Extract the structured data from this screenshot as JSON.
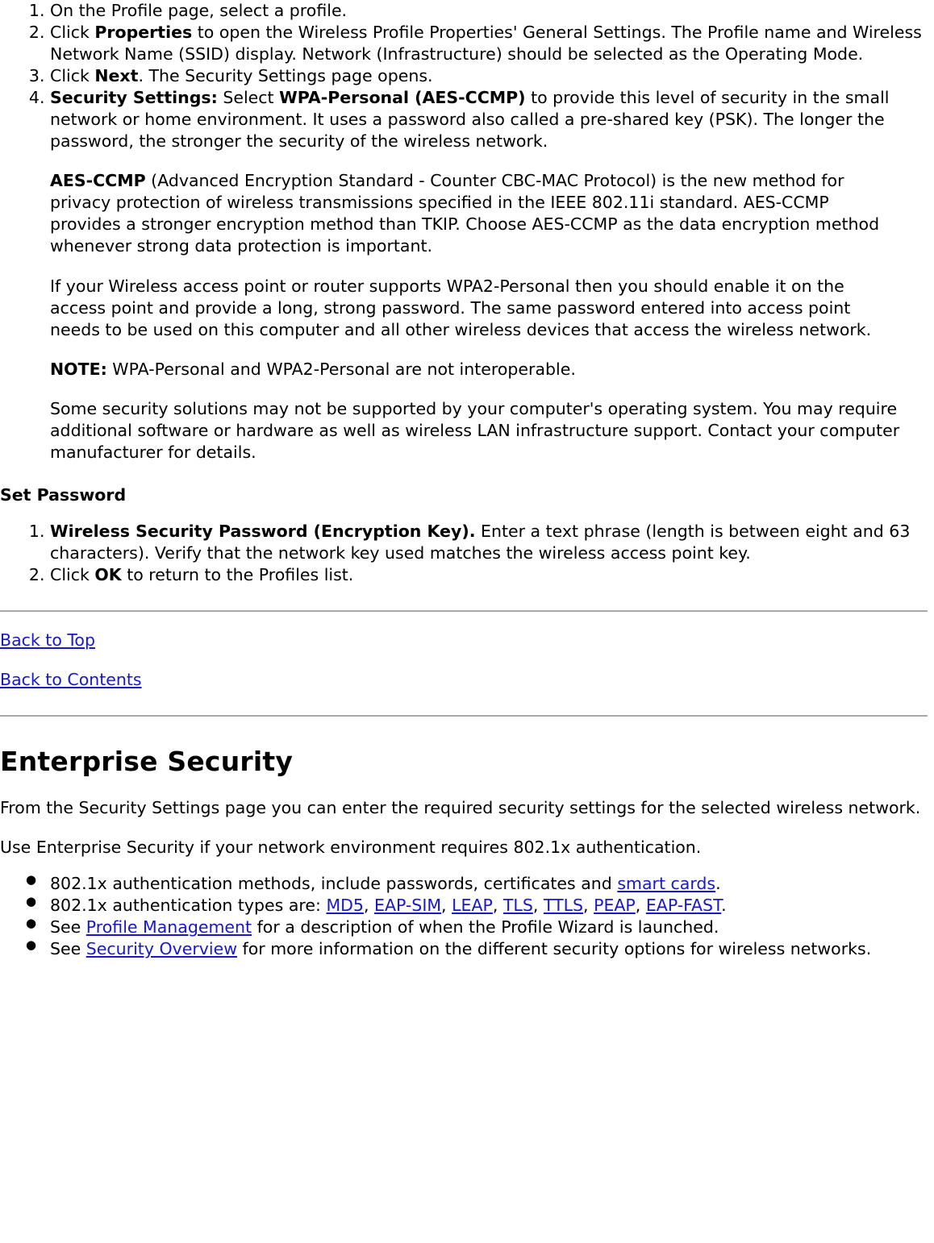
{
  "doc": {
    "steps_top": [
      {
        "id": "step-profile-select",
        "segments": [
          {
            "text": "On the Profile page, select a profile.",
            "bold": false
          }
        ]
      },
      {
        "id": "step-properties",
        "segments": [
          {
            "text": "Click ",
            "bold": false
          },
          {
            "text": "Properties",
            "bold": true
          },
          {
            "text": " to open the Wireless Profile Properties' General Settings. The Profile name and Wireless Network Name (SSID) display. Network (Infrastructure) should be selected as the Operating Mode.",
            "bold": false
          }
        ]
      },
      {
        "id": "step-next",
        "segments": [
          {
            "text": "Click ",
            "bold": false
          },
          {
            "text": "Next",
            "bold": true
          },
          {
            "text": ". The Security Settings page opens.",
            "bold": false
          }
        ]
      },
      {
        "id": "step-security-settings",
        "segments": [
          {
            "text": "Security Settings:",
            "bold": true
          },
          {
            "text": " Select ",
            "bold": false
          },
          {
            "text": "WPA-Personal (AES-CCMP)",
            "bold": true
          },
          {
            "text": " to provide this level of security in the small network or home environment. It uses a password also called a pre-shared key (PSK). The longer the password, the stronger the security of the wireless network.",
            "bold": false
          }
        ]
      }
    ],
    "paragraphs": [
      {
        "id": "para-aes-ccmp",
        "segments": [
          {
            "text": "AES-CCMP",
            "bold": true
          },
          {
            "text": " (Advanced Encryption Standard - Counter CBC-MAC Protocol) is the new method for privacy protection of wireless transmissions specified in the IEEE 802.11i standard. AES-CCMP provides a stronger encryption method than TKIP. Choose AES-CCMP as the data encryption method whenever strong data protection is important.",
            "bold": false
          }
        ]
      },
      {
        "id": "para-wpa2-router",
        "segments": [
          {
            "text": "If your Wireless access point or router supports WPA2-Personal then you should enable it on the access point and provide a long, strong password. The same password entered into access point needs to be used on this computer and all other wireless devices that access the wireless network.",
            "bold": false
          }
        ]
      },
      {
        "id": "para-note",
        "segments": [
          {
            "text": "NOTE:",
            "bold": true
          },
          {
            "text": " WPA-Personal and WPA2-Personal are not interoperable.",
            "bold": false
          }
        ]
      },
      {
        "id": "para-security-solutions",
        "segments": [
          {
            "text": "Some security solutions may not be supported by your computer's operating system. You may require additional software or hardware as well as wireless LAN infrastructure support. Contact your computer manufacturer for details.",
            "bold": false
          }
        ]
      }
    ],
    "set_password_heading": "Set Password",
    "steps_password": [
      {
        "id": "step-wireless-password",
        "segments": [
          {
            "text": "Wireless Security Password (Encryption Key).",
            "bold": true
          },
          {
            "text": " Enter a text phrase (length is between eight and 63 characters). Verify that the network key used matches the wireless access point key.",
            "bold": false
          }
        ]
      },
      {
        "id": "step-ok",
        "segments": [
          {
            "text": "Click ",
            "bold": false
          },
          {
            "text": "OK",
            "bold": true
          },
          {
            "text": " to return to the Profiles list.",
            "bold": false
          }
        ]
      }
    ],
    "nav_links": [
      {
        "id": "back-to-top",
        "label": "Back to Top"
      },
      {
        "id": "back-to-contents",
        "label": "Back to Contents"
      }
    ],
    "enterprise": {
      "title": "Enterprise Security",
      "intro1": "From the Security Settings page you can enter the required security settings for the selected wireless network.",
      "intro2": "Use Enterprise Security if your network environment requires 802.1x authentication.",
      "bullets": [
        {
          "id": "bullet-auth-methods",
          "segments": [
            {
              "text": "802.1x authentication methods, include passwords, certificates and ",
              "kind": "text"
            },
            {
              "text": "smart cards",
              "kind": "link"
            },
            {
              "text": ".",
              "kind": "text"
            }
          ]
        },
        {
          "id": "bullet-auth-types",
          "segments": [
            {
              "text": "802.1x authentication types are:  ",
              "kind": "text"
            },
            {
              "text": "MD5",
              "kind": "link"
            },
            {
              "text": ", ",
              "kind": "text"
            },
            {
              "text": "EAP-SIM",
              "kind": "link"
            },
            {
              "text": ", ",
              "kind": "text"
            },
            {
              "text": "LEAP",
              "kind": "link"
            },
            {
              "text": ", ",
              "kind": "text"
            },
            {
              "text": "TLS",
              "kind": "link"
            },
            {
              "text": ", ",
              "kind": "text"
            },
            {
              "text": "TTLS",
              "kind": "link"
            },
            {
              "text": ", ",
              "kind": "text"
            },
            {
              "text": "PEAP",
              "kind": "link"
            },
            {
              "text": ", ",
              "kind": "text"
            },
            {
              "text": "EAP-FAST",
              "kind": "link"
            },
            {
              "text": ".",
              "kind": "text"
            }
          ]
        },
        {
          "id": "bullet-profile-management",
          "segments": [
            {
              "text": "See ",
              "kind": "text"
            },
            {
              "text": "Profile Management",
              "kind": "link"
            },
            {
              "text": " for a description of when the Profile Wizard is launched.",
              "kind": "text"
            }
          ]
        },
        {
          "id": "bullet-security-overview",
          "segments": [
            {
              "text": "See ",
              "kind": "text"
            },
            {
              "text": "Security Overview",
              "kind": "link"
            },
            {
              "text": " for more information on the different security options for wireless networks.",
              "kind": "text"
            }
          ]
        }
      ]
    },
    "colors": {
      "link": "#1818c8",
      "rule": "#a8a8a8",
      "text": "#000000"
    }
  }
}
